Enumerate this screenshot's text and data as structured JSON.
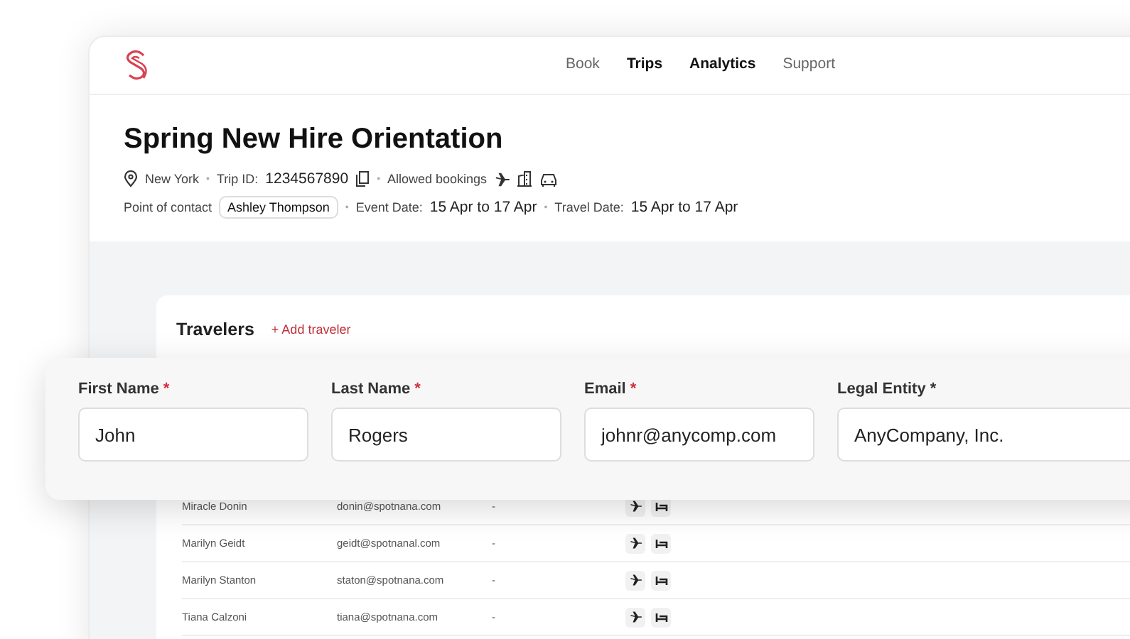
{
  "nav": [
    {
      "label": "Book",
      "selected": false
    },
    {
      "label": "Trips",
      "selected": true
    },
    {
      "label": "Analytics",
      "selected": true
    },
    {
      "label": "Support",
      "selected": false
    }
  ],
  "trip": {
    "title": "Spring New Hire Orientation",
    "location": "New York",
    "trip_id_label": "Trip ID:",
    "trip_id": "1234567890",
    "allowed_label": "Allowed bookings",
    "contact_label": "Point of contact",
    "contact": "Ashley Thompson",
    "event_label": "Event Date:",
    "event_date": "15 Apr to 17 Apr",
    "travel_label": "Travel Date:",
    "travel_date": "15 Apr to 17 Apr",
    "separators": [
      "•",
      "•",
      "•",
      "•"
    ]
  },
  "travelers": {
    "title": "Travelers",
    "add_label": "+ Add traveler",
    "rows": [
      {
        "name": "Miracle Donin",
        "email": "donin@spotnana.com",
        "column_3": "-"
      },
      {
        "name": "Marilyn Geidt",
        "email": "geidt@spotnanal.com",
        "column_3": "-"
      },
      {
        "name": "Marilyn Stanton",
        "email": "staton@spotnana.com",
        "column_3": "-"
      },
      {
        "name": "Tiana Calzoni",
        "email": "tiana@spotnana.com",
        "column_3": "-"
      }
    ]
  },
  "form": {
    "fields": [
      {
        "label": "First Name",
        "asterisk": "*",
        "required": true,
        "value": "John"
      },
      {
        "label": "Last Name",
        "asterisk": "*",
        "required": true,
        "value": "Rogers"
      },
      {
        "label": "Email",
        "asterisk": "*",
        "required": true,
        "value": "johnr@anycomp.com"
      },
      {
        "label": "Legal Entity",
        "asterisk": "*",
        "required": false,
        "value": "AnyCompany, Inc."
      }
    ]
  }
}
